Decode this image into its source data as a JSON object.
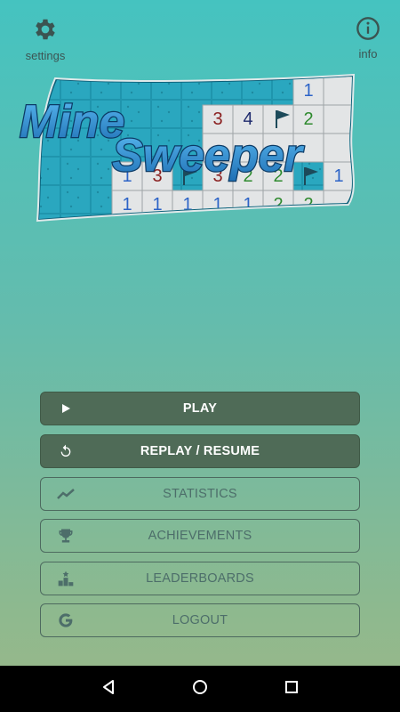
{
  "header": {
    "settings_label": "settings",
    "info_label": "info"
  },
  "logo": {
    "word1": "Mine",
    "word2": "Sweeper",
    "grid_rows": [
      [
        "",
        "",
        "",
        "",
        "",
        "",
        "",
        "",
        "1",
        ""
      ],
      [
        "",
        "",
        "",
        "",
        "",
        "3",
        "4",
        "F",
        "2",
        ""
      ],
      [
        "",
        "",
        "",
        "",
        "",
        "",
        "",
        "",
        "",
        ""
      ],
      [
        "",
        "",
        "",
        "1",
        "3",
        "F",
        "3",
        "2",
        "2",
        "F",
        "1"
      ],
      [
        "",
        "",
        "",
        "1",
        "1",
        "1",
        "1",
        "1",
        "2",
        "2"
      ]
    ]
  },
  "menu": {
    "play": "PLAY",
    "replay": "REPLAY / RESUME",
    "statistics": "STATISTICS",
    "achievements": "ACHIEVEMENTS",
    "leaderboards": "LEADERBOARDS",
    "logout": "LOGOUT"
  },
  "icons": {
    "settings": "gear-icon",
    "info": "info-icon",
    "play": "play-icon",
    "replay": "replay-icon",
    "statistics": "trend-icon",
    "achievements": "trophy-icon",
    "leaderboards": "podium-icon",
    "logout": "google-icon"
  },
  "colors": {
    "dark_button": "#4f6b57",
    "outline": "#4d6a5f",
    "logo_blue": "#2f8fd0"
  }
}
